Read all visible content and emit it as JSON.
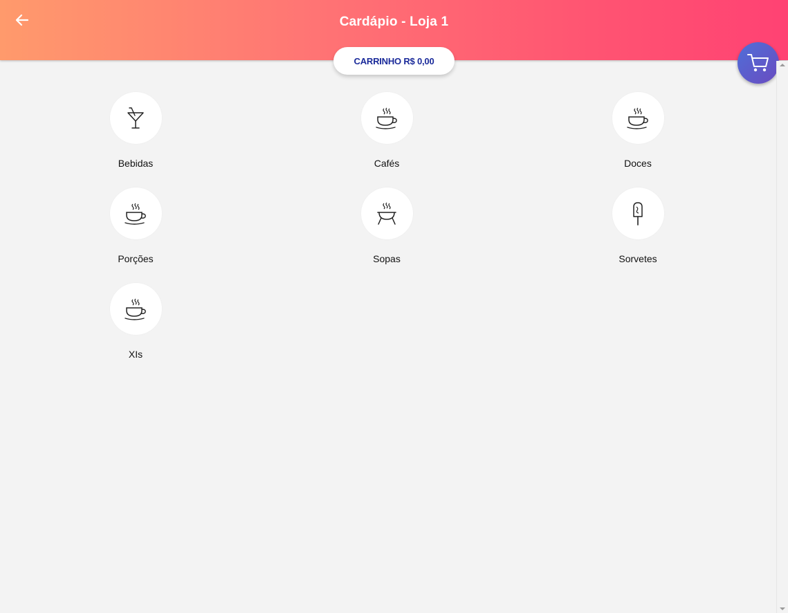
{
  "header": {
    "title": "Cardápio - Loja 1",
    "back_icon": "arrow-left-icon"
  },
  "cart": {
    "label": "CARRINHO R$ 0,00",
    "fab_icon": "shopping-cart-icon"
  },
  "categories": [
    {
      "label": "Bebidas",
      "icon": "cocktail-icon"
    },
    {
      "label": "Cafés",
      "icon": "coffee-cup-icon"
    },
    {
      "label": "Doces",
      "icon": "coffee-cup-icon"
    },
    {
      "label": "Porções",
      "icon": "coffee-cup-icon"
    },
    {
      "label": "Sopas",
      "icon": "soup-pot-icon"
    },
    {
      "label": "Sorvetes",
      "icon": "popsicle-icon"
    },
    {
      "label": "XIs",
      "icon": "coffee-cup-icon"
    }
  ],
  "colors": {
    "header_gradient_start": "#ff9a6c",
    "header_gradient_end": "#ff4273",
    "cart_text": "#1a2a9a",
    "fab_start": "#4f6fd8",
    "fab_end": "#6a4bc0",
    "background": "#f3f3f3"
  }
}
